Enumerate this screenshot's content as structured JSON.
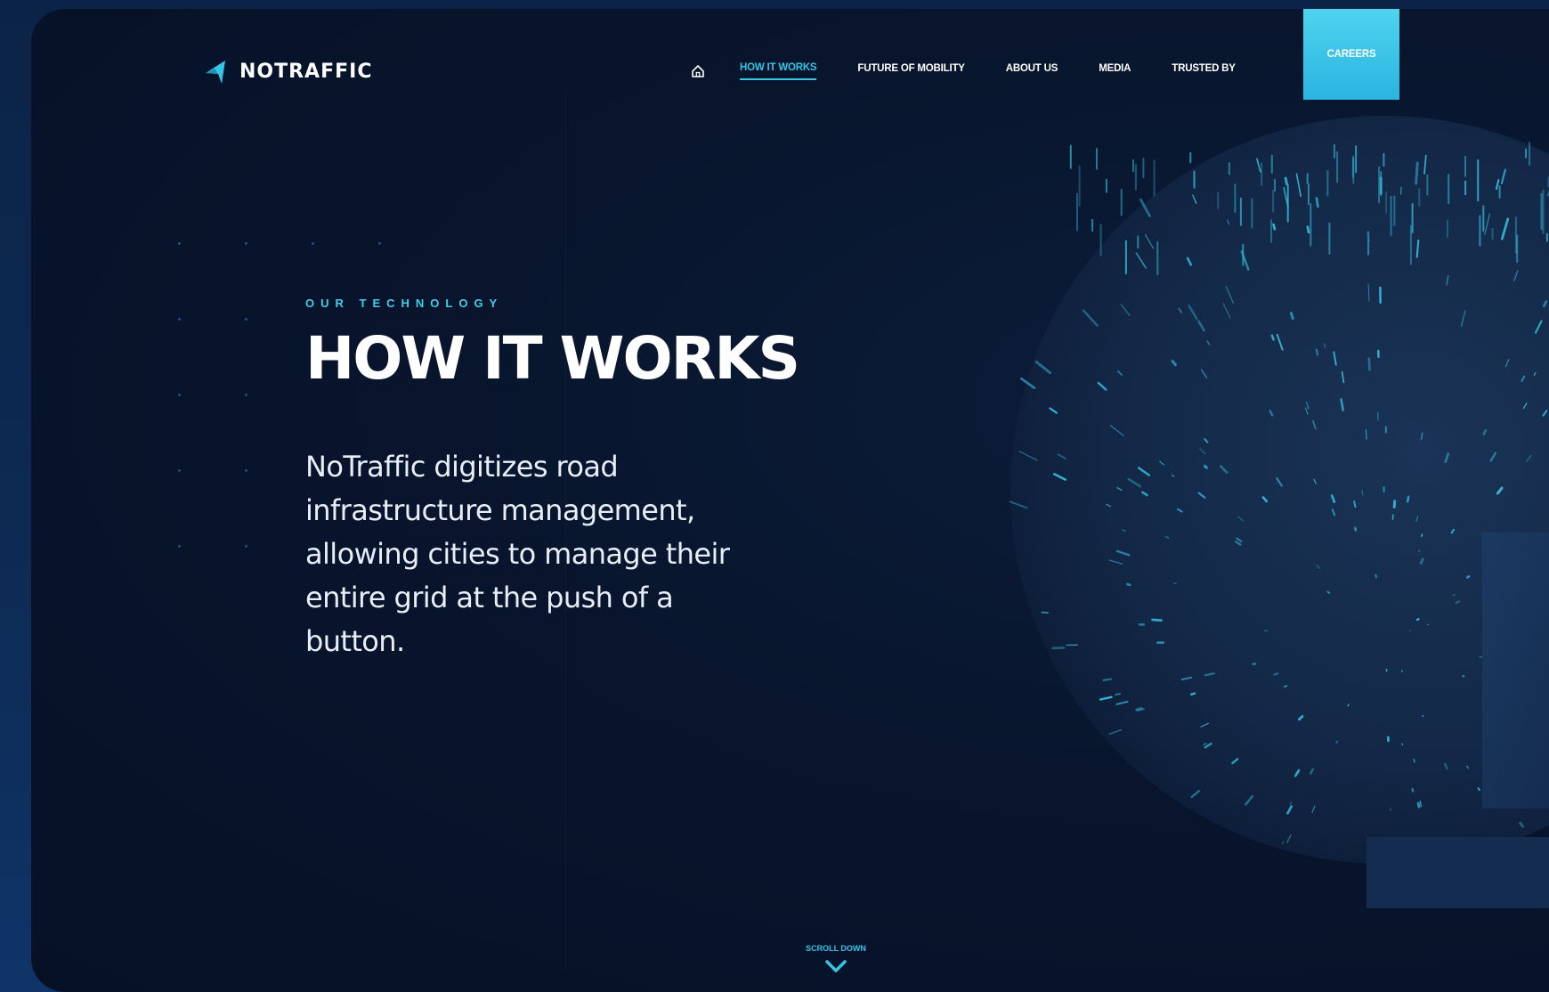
{
  "brand": {
    "name": "NOTRAFFIC",
    "logo_icon": "notraffic-logo-icon",
    "accent": "#37c5e5"
  },
  "nav": {
    "home_icon": "home-icon",
    "items": [
      {
        "label": "HOW IT WORKS",
        "active": true
      },
      {
        "label": "FUTURE OF MOBILITY",
        "active": false
      },
      {
        "label": "ABOUT US",
        "active": false
      },
      {
        "label": "MEDIA",
        "active": false
      },
      {
        "label": "TRUSTED BY",
        "active": false
      }
    ],
    "cta_label": "CAREERS"
  },
  "hero": {
    "eyebrow": "OUR TECHNOLOGY",
    "title": "HOW IT WORKS",
    "description": "NoTraffic digitizes road infrastructure management, allowing cities to manage their entire grid at the push of a button."
  },
  "scroll": {
    "label": "SCROLL DOWN",
    "icon": "chevron-down-icon"
  },
  "colors": {
    "background": "#061126",
    "text": "#ffffff",
    "accent": "#37c5e5",
    "cta": "#3cc8e8"
  }
}
